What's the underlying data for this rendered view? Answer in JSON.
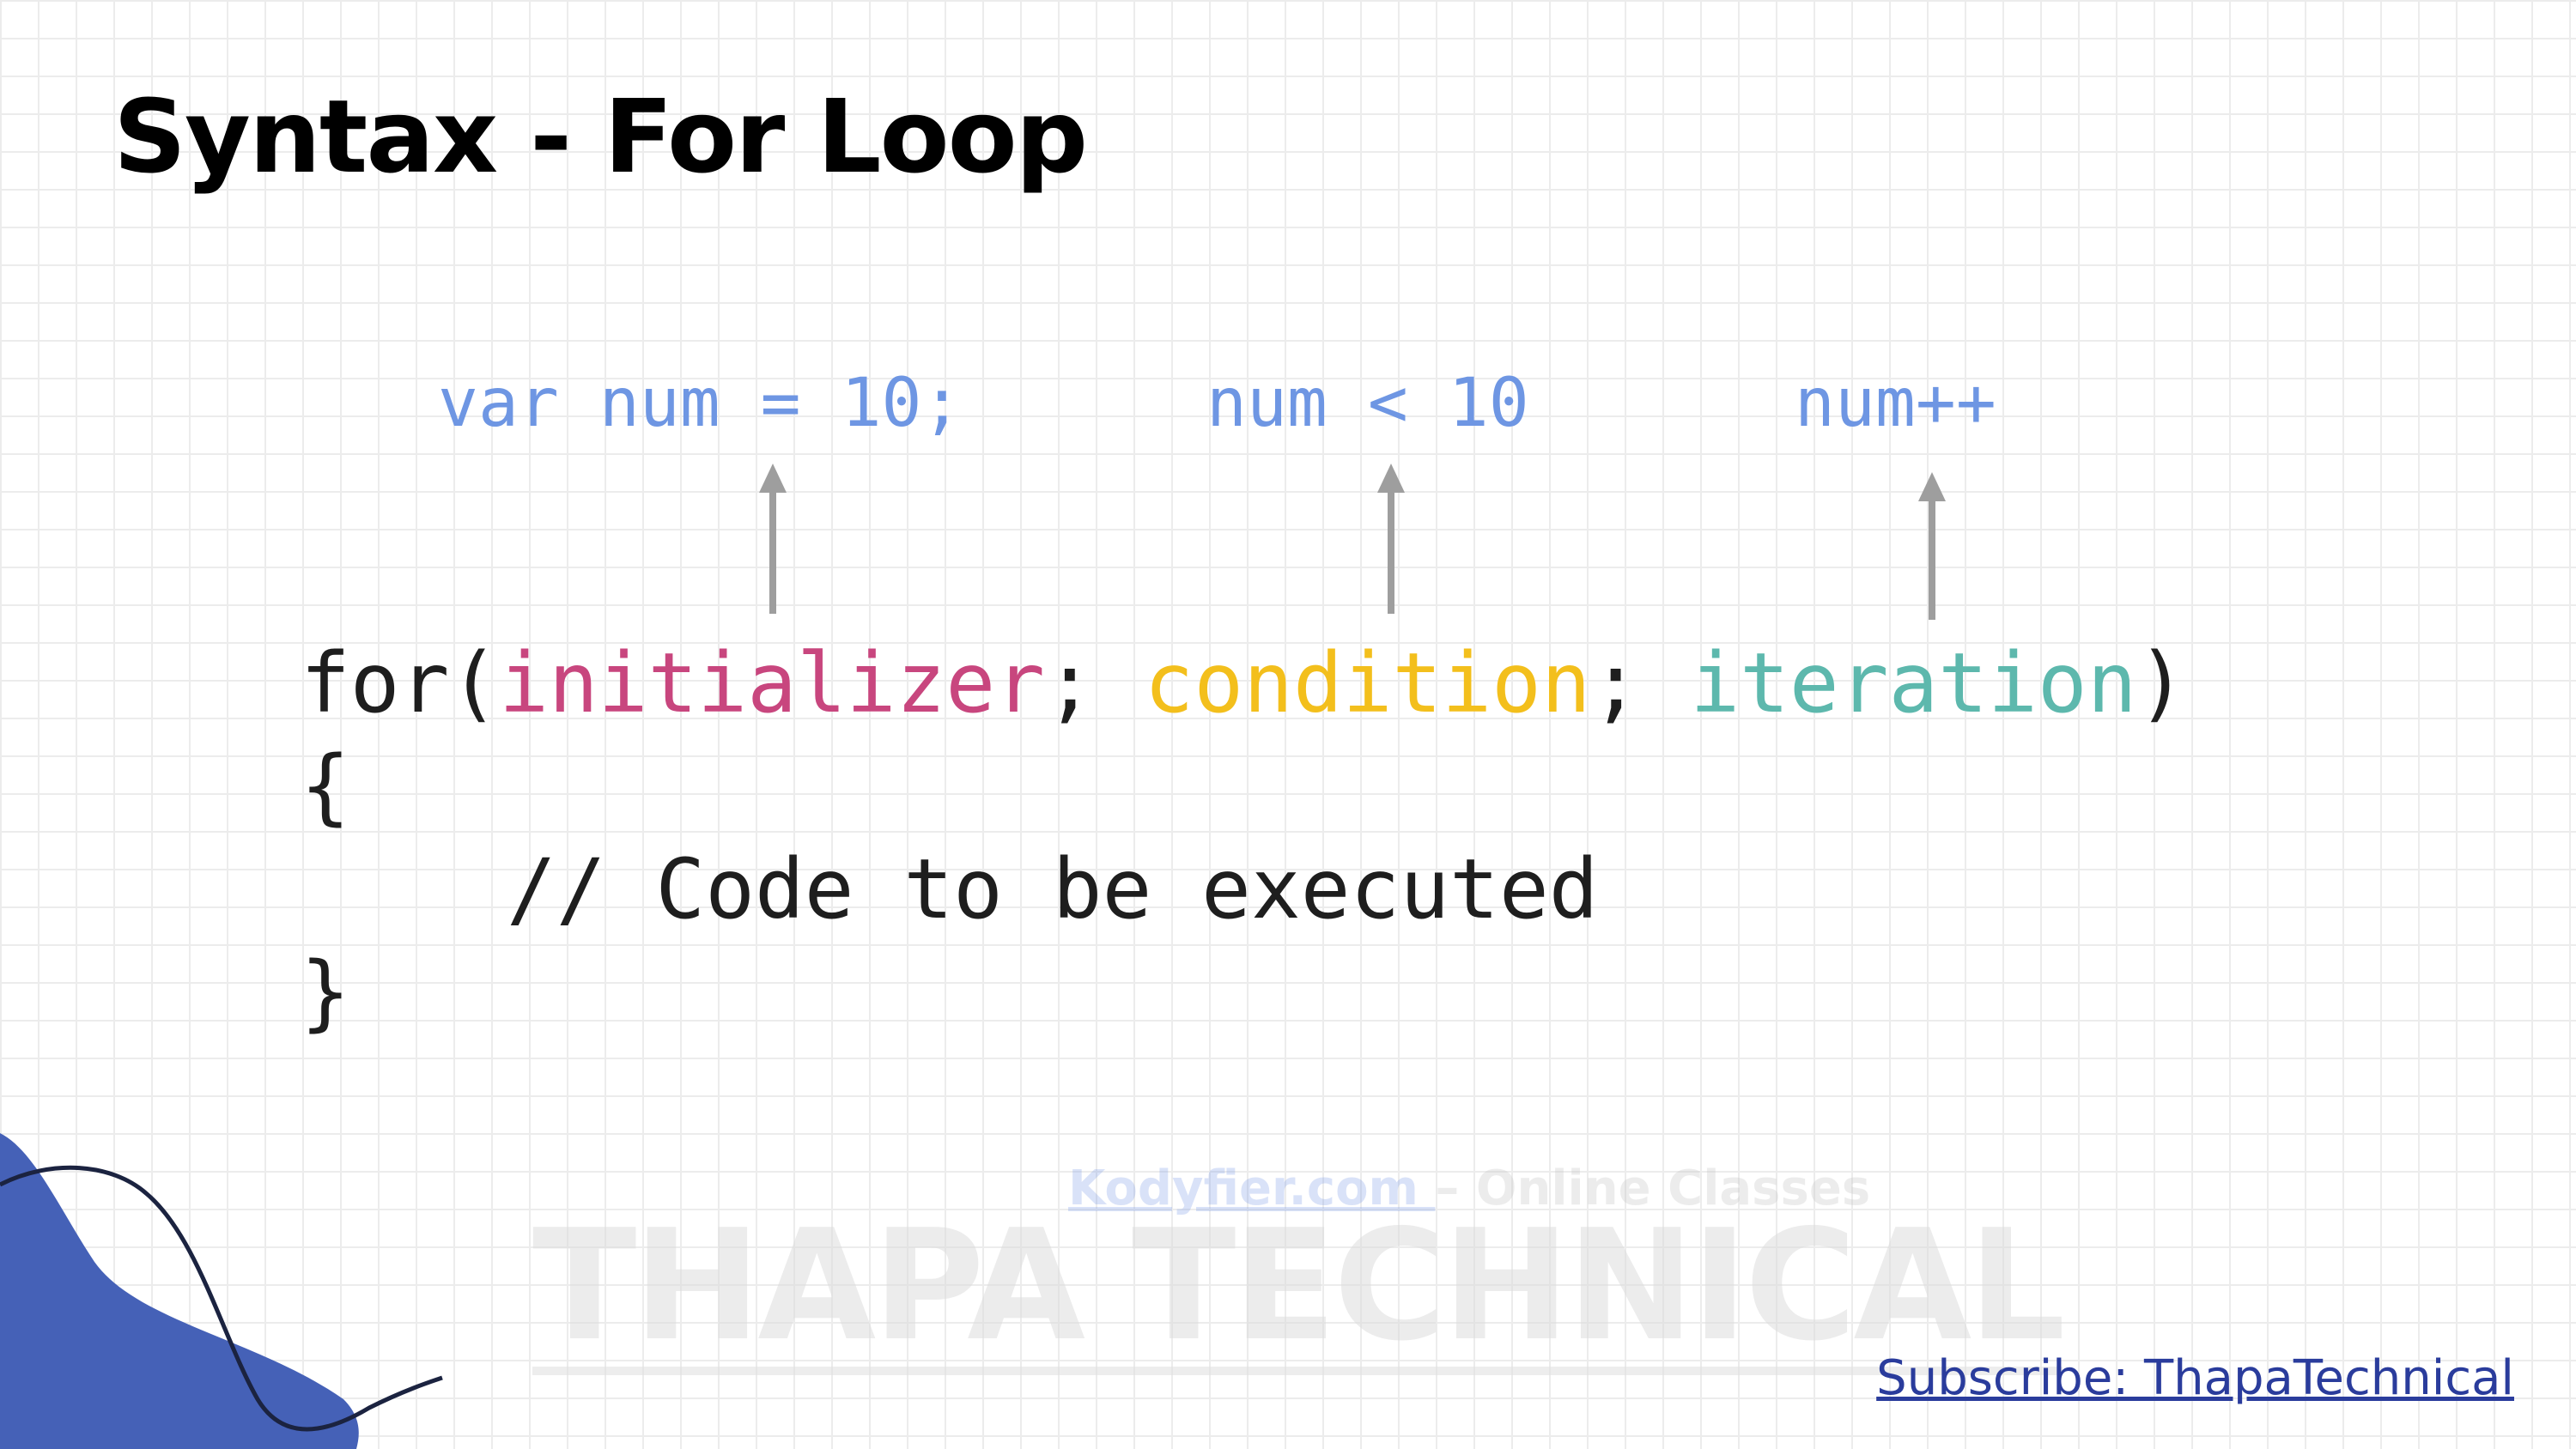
{
  "slide": {
    "title": "Syntax - For Loop"
  },
  "hints": {
    "initializer_example": "var num = 10;",
    "condition_example": "num < 10",
    "iteration_example": "num++"
  },
  "code": {
    "for_keyword": "for(",
    "initializer": "initializer",
    "sep1": "; ",
    "condition": "condition",
    "sep2": "; ",
    "iteration": "iteration",
    "close_paren": ")",
    "open_brace": "{",
    "comment": "// Code to be executed",
    "close_brace": "}"
  },
  "watermark": {
    "site": "Kodyfier.com ",
    "site_suffix": "– Online Classes",
    "brand": "THAPA TECHNICAL"
  },
  "footer": {
    "subscribe": "Subscribe: ThapaTechnical"
  },
  "colors": {
    "initializer": "#c8467e",
    "condition": "#f3bf1c",
    "iteration": "#5db8ad",
    "hint": "#6e96e3",
    "blob": "#4561b7",
    "subscribe": "#2a3c9c"
  }
}
